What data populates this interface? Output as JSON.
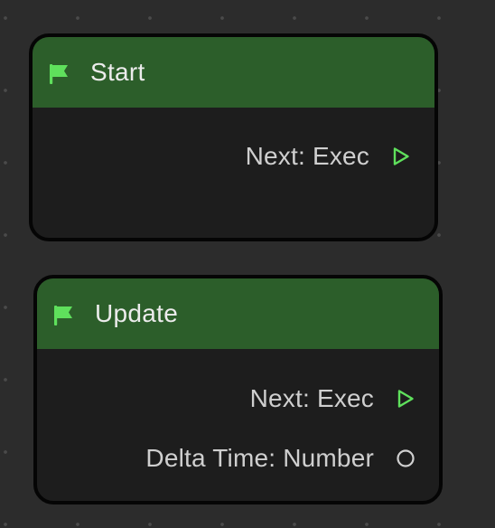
{
  "colors": {
    "canvas_bg": "#2c2c2c",
    "grid_dot": "#4a4a4a",
    "node_body": "#1d1d1d",
    "node_border": "#050505",
    "header_green": "#2c5e2a",
    "flag_green": "#5fe05c",
    "exec_pin": "#5fe05c",
    "data_pin": "#d0d0d0",
    "title_text": "#ececec",
    "label_text": "#cfcfcf"
  },
  "nodes": [
    {
      "id": "start",
      "icon": "flag-icon",
      "title": "Start",
      "outputs": [
        {
          "label": "Next: Exec",
          "pin": "exec-triangle-icon"
        }
      ]
    },
    {
      "id": "update",
      "icon": "flag-icon",
      "title": "Update",
      "outputs": [
        {
          "label": "Next: Exec",
          "pin": "exec-triangle-icon"
        },
        {
          "label": "Delta Time: Number",
          "pin": "data-circle-icon"
        }
      ]
    }
  ]
}
